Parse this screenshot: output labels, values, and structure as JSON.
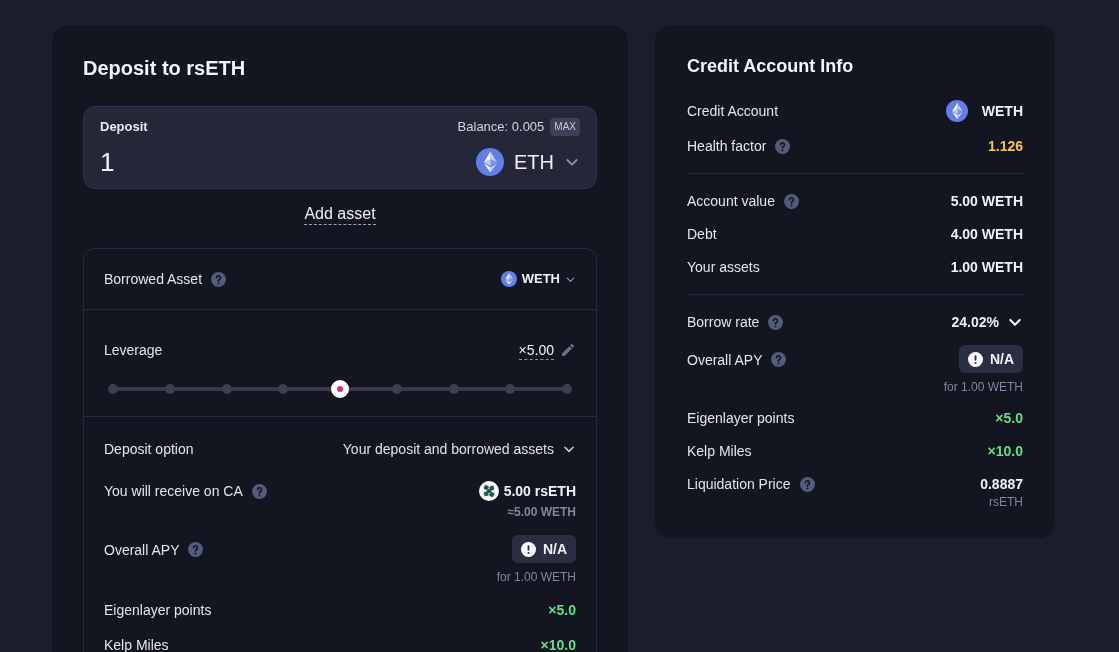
{
  "deposit_panel": {
    "title": "Deposit to rsETH",
    "deposit_field": {
      "label": "Deposit",
      "balance": "Balance: 0.005",
      "max_button": "MAX",
      "value": "1",
      "token": "ETH"
    },
    "add_asset_link": "Add asset",
    "borrowed_asset": {
      "label": "Borrowed Asset",
      "help": true,
      "token": "WETH"
    },
    "leverage": {
      "label": "Leverage",
      "value": "×5.00",
      "level": 0.5
    },
    "details": [
      {
        "kind": "select",
        "label": "Deposit option",
        "value": "Your deposit and borrowed assets"
      },
      {
        "kind": "receive",
        "label": "You will receive on CA",
        "help": true,
        "value": "5.00 rsETH",
        "sub": "≈5.00 WETH"
      },
      {
        "kind": "badge",
        "label": "Overall APY",
        "help": true,
        "value": "N/A",
        "sub": "for 1.00 WETH"
      },
      {
        "kind": "text",
        "label": "Eigenlayer points",
        "value": "×5.0",
        "color": "#5de18b"
      },
      {
        "kind": "text",
        "label": "Kelp Miles",
        "value": "×10.0",
        "color": "#5de18b"
      }
    ]
  },
  "credit_account_panel": {
    "title": "Credit Account Info",
    "sections": [
      {
        "rows": [
          {
            "kind": "asset",
            "label": "Credit Account",
            "value": "WETH"
          },
          {
            "kind": "text",
            "label": "Health factor",
            "help": true,
            "value": "1.126",
            "color": "#f5c64b"
          }
        ]
      },
      {
        "rows": [
          {
            "kind": "text",
            "label": "Account value",
            "help": true,
            "value": "5.00 WETH"
          },
          {
            "kind": "text",
            "label": "Debt",
            "value": "4.00 WETH"
          },
          {
            "kind": "text",
            "label": "Your assets",
            "value": "1.00 WETH"
          }
        ]
      },
      {
        "rows": [
          {
            "kind": "select",
            "label": "Borrow rate",
            "help": true,
            "value": "24.02%"
          },
          {
            "kind": "badge",
            "label": "Overall APY",
            "help": true,
            "value": "N/A",
            "sub": "for 1.00 WETH"
          },
          {
            "kind": "text",
            "label": "Eigenlayer points",
            "value": "×5.0",
            "color": "#5de18b"
          },
          {
            "kind": "text",
            "label": "Kelp Miles",
            "value": "×10.0",
            "color": "#5de18b"
          },
          {
            "kind": "text",
            "label": "Liquidation Price",
            "help": true,
            "value": "0.8887",
            "sub": "rsETH"
          }
        ]
      }
    ]
  }
}
